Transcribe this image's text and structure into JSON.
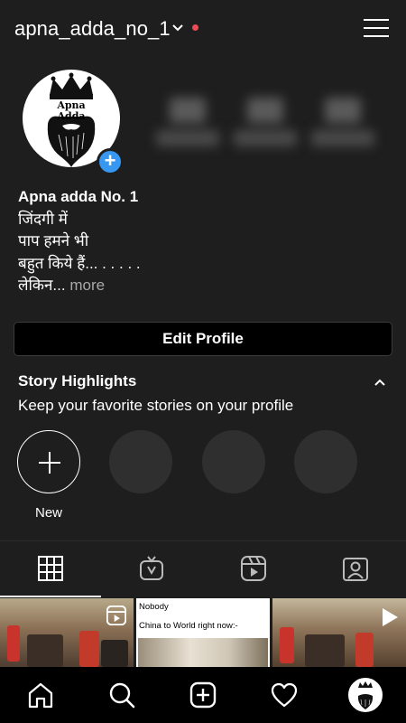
{
  "header": {
    "username": "apna_adda_no_1",
    "icons": {
      "dropdown": "chevron-down-icon",
      "notification": "notification-dot",
      "menu": "hamburger-menu-icon"
    },
    "accent_dot_color": "#ed4956"
  },
  "profile": {
    "avatar_logo_text": "Apna Adda",
    "add_badge_icon": "plus-icon",
    "add_badge_color": "#3897f0",
    "stats_blurred": true
  },
  "bio": {
    "name": "Apna adda No. 1",
    "lines": [
      "जिंदगी में",
      "पाप हमने भी",
      "बहुत किये हैं... . . . . .",
      "लेकिन..."
    ],
    "more": "more"
  },
  "edit_profile": {
    "label": "Edit Profile"
  },
  "highlights": {
    "title": "Story Highlights",
    "subtitle": "Keep your favorite stories on your profile",
    "new_label": "New",
    "collapse_icon": "chevron-up-icon"
  },
  "tabs": [
    {
      "icon": "grid-icon",
      "active": true
    },
    {
      "icon": "igtv-icon",
      "active": false
    },
    {
      "icon": "reels-icon",
      "active": false
    },
    {
      "icon": "tagged-icon",
      "active": false
    }
  ],
  "posts": [
    {
      "kind": "reel",
      "icon": "reel-icon"
    },
    {
      "kind": "image",
      "caption_1": "Nobody",
      "caption_2": "China to World right now:-"
    },
    {
      "kind": "video",
      "icon": "play-icon"
    }
  ],
  "bottom_nav": [
    "home-icon",
    "search-icon",
    "new-post-icon",
    "activity-heart-icon",
    "profile-avatar"
  ]
}
